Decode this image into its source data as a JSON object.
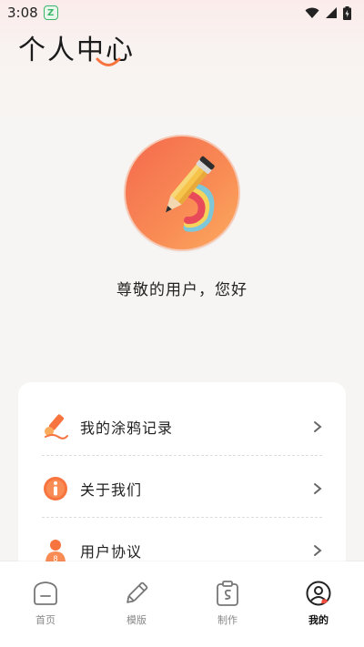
{
  "status_bar": {
    "time": "3:08",
    "app_badge": "Z"
  },
  "header": {
    "title": "个人中心"
  },
  "profile": {
    "greeting": "尊敬的用户，您好"
  },
  "menu": {
    "items": [
      {
        "label": "我的涂鸦记录",
        "icon": "brush-icon"
      },
      {
        "label": "关于我们",
        "icon": "info-icon"
      },
      {
        "label": "用户协议",
        "icon": "user-icon"
      }
    ]
  },
  "bottom_nav": {
    "items": [
      {
        "label": "首页",
        "icon": "home-icon",
        "active": false
      },
      {
        "label": "模版",
        "icon": "pencil-icon",
        "active": false
      },
      {
        "label": "制作",
        "icon": "clipboard-icon",
        "active": false
      },
      {
        "label": "我的",
        "icon": "profile-icon",
        "active": true
      }
    ]
  },
  "colors": {
    "accent": "#f7743f",
    "accent_light": "#fbab5e",
    "background": "#f7f5f3"
  }
}
